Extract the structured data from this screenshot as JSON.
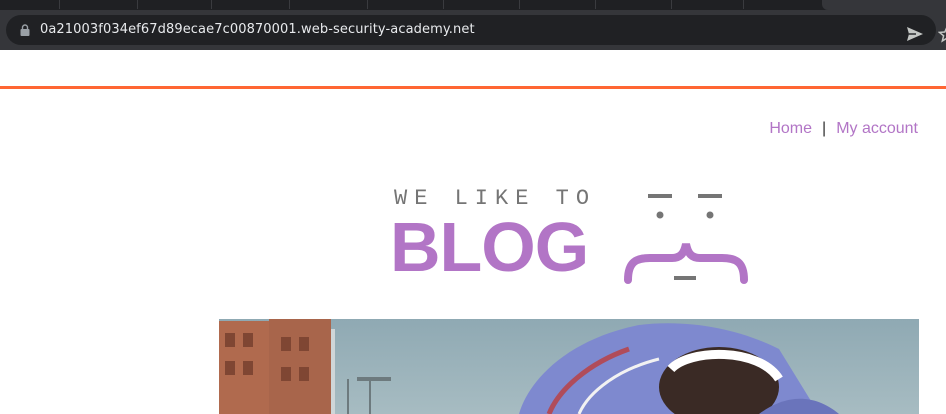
{
  "browser": {
    "url": "0a21003f034ef67d89ecae7c00870001.web-security-academy.net",
    "icons": [
      "lock-icon",
      "send-icon",
      "star-icon"
    ]
  },
  "nav": {
    "home": "Home",
    "separator": "|",
    "account": "My account"
  },
  "logo": {
    "tagline": "WE LIKE TO",
    "wordmark": "BLOG"
  },
  "colors": {
    "accent": "#ff6633",
    "brand": "#b275c6",
    "chrome_dark": "#202124",
    "chrome": "#35363a"
  }
}
